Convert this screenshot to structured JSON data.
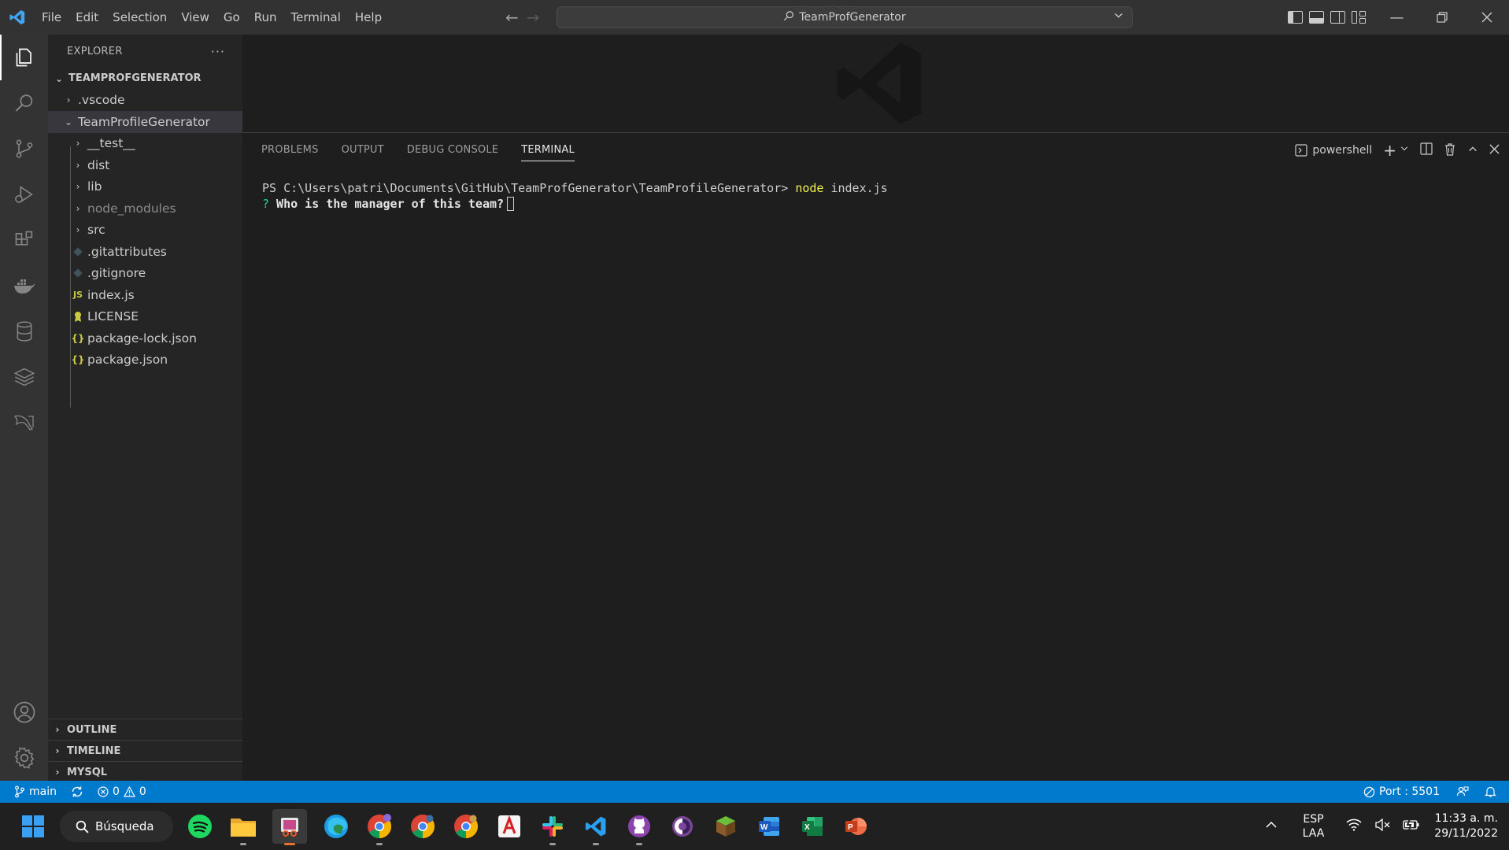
{
  "menu": [
    "File",
    "Edit",
    "Selection",
    "View",
    "Go",
    "Run",
    "Terminal",
    "Help"
  ],
  "command_center": {
    "title": "TeamProfGenerator"
  },
  "sidebar": {
    "header": "EXPLORER",
    "root": "TEAMPROFGENERATOR",
    "items": [
      {
        "label": ".vscode",
        "type": "folder",
        "expanded": false,
        "depth": 0
      },
      {
        "label": "TeamProfileGenerator",
        "type": "folder",
        "expanded": true,
        "depth": 0,
        "selected": true
      },
      {
        "label": "__test__",
        "type": "folder",
        "expanded": false,
        "depth": 1
      },
      {
        "label": "dist",
        "type": "folder",
        "expanded": false,
        "depth": 1
      },
      {
        "label": "lib",
        "type": "folder",
        "expanded": false,
        "depth": 1
      },
      {
        "label": "node_modules",
        "type": "folder",
        "expanded": false,
        "depth": 1,
        "dimmed": true
      },
      {
        "label": "src",
        "type": "folder",
        "expanded": false,
        "depth": 1
      },
      {
        "label": ".gitattributes",
        "type": "git",
        "depth": 1
      },
      {
        "label": ".gitignore",
        "type": "git",
        "depth": 1
      },
      {
        "label": "index.js",
        "type": "js",
        "depth": 1
      },
      {
        "label": "LICENSE",
        "type": "license",
        "depth": 1
      },
      {
        "label": "package-lock.json",
        "type": "json",
        "depth": 1
      },
      {
        "label": "package.json",
        "type": "json",
        "depth": 1
      }
    ],
    "sections": [
      "OUTLINE",
      "TIMELINE",
      "MYSQL"
    ]
  },
  "panel": {
    "tabs": [
      "PROBLEMS",
      "OUTPUT",
      "DEBUG CONSOLE",
      "TERMINAL"
    ],
    "active_tab": "TERMINAL",
    "shell": "powershell",
    "prompt": "PS C:\\Users\\patri\\Documents\\GitHub\\TeamProfGenerator\\TeamProfileGenerator>",
    "command_name": "node",
    "command_arg": " index.js",
    "question_mark": "?",
    "question": " Who is the manager of this team?"
  },
  "statusbar": {
    "branch": "main",
    "errors": "0",
    "warnings": "0",
    "port": "Port : 5501"
  },
  "taskbar": {
    "search": "Búsqueda",
    "lang_top": "ESP",
    "lang_bottom": "LAA",
    "time": "11:33 a. m.",
    "date": "29/11/2022",
    "apps": [
      "spotify-icon",
      "file-explorer-icon",
      "snipping-tool-icon",
      "edge-icon",
      "chrome-icon",
      "chrome-profile-2-icon",
      "chrome-profile-3-icon",
      "acrobat-icon",
      "slack-icon",
      "vscode-icon",
      "github-desktop-icon",
      "tor-browser-icon",
      "minecraft-icon",
      "word-icon",
      "excel-icon",
      "powerpoint-icon"
    ]
  },
  "colors": {
    "accent": "#007acc",
    "sidebar": "#252526",
    "editor": "#1e1e1e",
    "activitybar": "#333333",
    "titlebar": "#323233"
  }
}
